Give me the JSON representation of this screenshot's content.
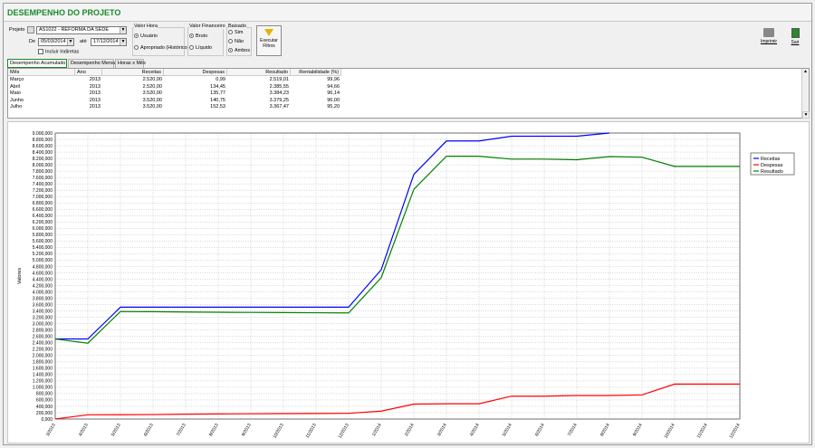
{
  "title": "DESEMPENHO DO PROJETO",
  "filters": {
    "projeto_label": "Projeto",
    "projeto_value": "AS1022 - REFORMA DA SEDE",
    "de_label": "De",
    "de_value": "05/03/2014",
    "ate_label": "até",
    "ate_value": "17/12/2014",
    "incluir_indiretas": "Incluir Indiretas",
    "valor_hora_label": "Valor Hora",
    "vh_usuario": "Usuário",
    "vh_apropriado": "Apropriado (Histórico)",
    "valor_fin_label": "Valor Financeiro",
    "vf_bruto": "Bruto",
    "vf_liquido": "Líquido",
    "baixado_label": "Baixado",
    "b_sim": "Sim",
    "b_nao": "Não",
    "b_ambos": "Ambos",
    "executar": "Executar Filtros"
  },
  "actions": {
    "imprimir": "Imprimir",
    "sair": "Sair"
  },
  "tabs": [
    "Desempenho Acumulado",
    "Desempenho Mensal",
    "Horas x Mês"
  ],
  "table": {
    "columns": [
      "Mês",
      "Ano",
      "Receitas",
      "Despesas",
      "Resultado",
      "Rentabilidade (%)"
    ],
    "rows": [
      [
        "Março",
        "2013",
        "2.520,00",
        "0,99",
        "2.519,01",
        "99,96"
      ],
      [
        "Abril",
        "2013",
        "2.520,00",
        "134,45",
        "2.385,55",
        "94,66"
      ],
      [
        "Maio",
        "2013",
        "3.520,00",
        "135,77",
        "3.384,23",
        "96,14"
      ],
      [
        "Junho",
        "2013",
        "3.520,00",
        "140,75",
        "3.379,25",
        "96,00"
      ],
      [
        "Julho",
        "2013",
        "3.520,00",
        "152,53",
        "3.367,47",
        "95,20"
      ]
    ]
  },
  "chart_data": {
    "type": "line",
    "ylabel": "Valores",
    "ylim": [
      0,
      9000
    ],
    "x": [
      "3/2013",
      "4/2013",
      "5/2013",
      "6/2013",
      "7/2013",
      "8/2013",
      "9/2013",
      "10/2013",
      "11/2013",
      "12/2013",
      "1/2014",
      "2/2014",
      "3/2014",
      "4/2014",
      "5/2014",
      "6/2014",
      "7/2014",
      "8/2014",
      "9/2014",
      "10/2014",
      "11/2014",
      "12/2014"
    ],
    "series": [
      {
        "name": "Receitas",
        "color": "#0000ff",
        "values": [
          2520,
          2520,
          3520,
          3520,
          3520,
          3520,
          3520,
          3520,
          3520,
          3520,
          4700,
          7700,
          8750,
          8750,
          8900,
          8900,
          8900,
          9000,
          null,
          null,
          null,
          null
        ]
      },
      {
        "name": "Despesas",
        "color": "#ff0000",
        "values": [
          1,
          134,
          136,
          141,
          153,
          160,
          165,
          170,
          175,
          180,
          250,
          470,
          480,
          480,
          720,
          720,
          740,
          740,
          760,
          1100,
          1100,
          1100
        ]
      },
      {
        "name": "Resultado",
        "color": "#008000",
        "values": [
          2519,
          2386,
          3384,
          3379,
          3367,
          3360,
          3355,
          3350,
          3345,
          3340,
          4450,
          7230,
          8270,
          8270,
          8180,
          8180,
          8160,
          8260,
          8240,
          7950,
          7950,
          7950
        ]
      }
    ],
    "legend": "right",
    "grid": true
  }
}
